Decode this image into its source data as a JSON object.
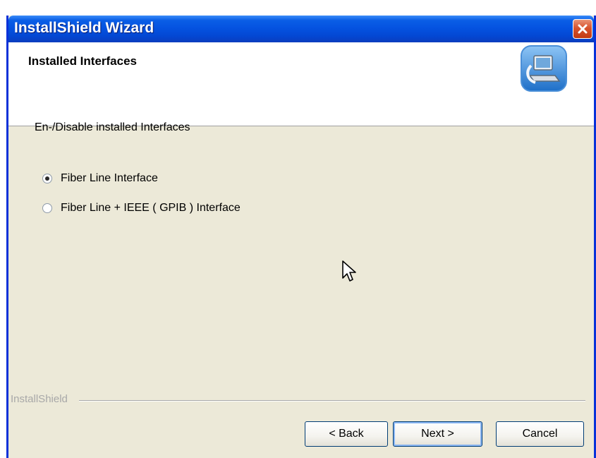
{
  "window": {
    "title": "InstallShield Wizard"
  },
  "header": {
    "title": "Installed Interfaces",
    "icon": "computer-install-icon"
  },
  "body": {
    "description": "En-/Disable installed Interfaces",
    "options": [
      {
        "label": "Fiber Line Interface",
        "selected": true
      },
      {
        "label": "Fiber Line + IEEE ( GPIB ) Interface",
        "selected": false
      }
    ]
  },
  "footer": {
    "brand": "InstallShield",
    "back_label": "< Back",
    "next_label": "Next >",
    "cancel_label": "Cancel"
  },
  "colors": {
    "titlebar": "#0553E1",
    "window_bg": "#ECE9D8",
    "close_button": "#D8532E"
  }
}
